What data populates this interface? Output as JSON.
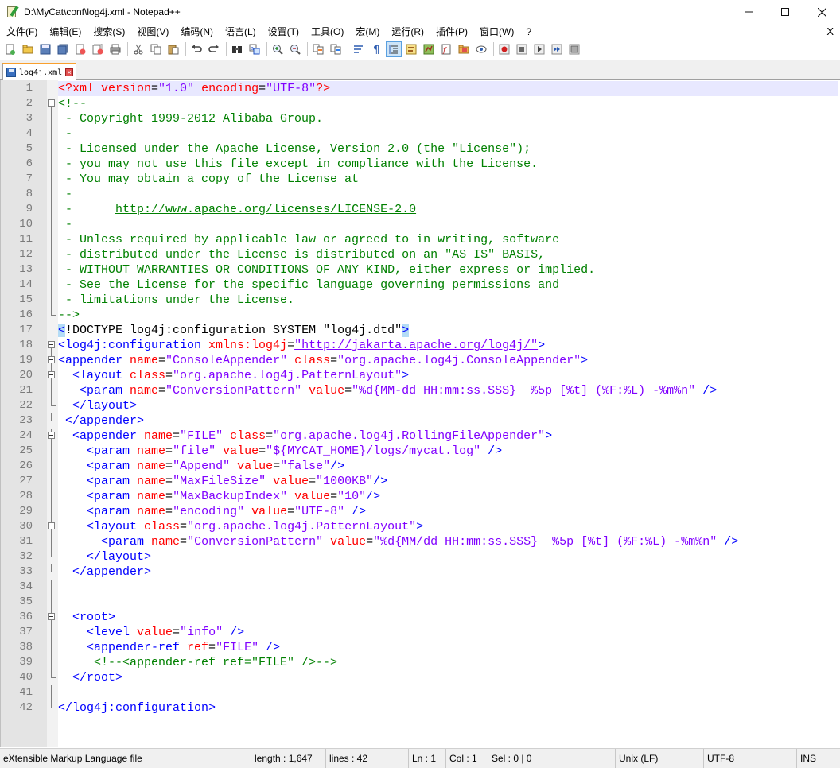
{
  "window": {
    "title": "D:\\MyCat\\conf\\log4j.xml - Notepad++",
    "minimize": "—",
    "maximize": "☐",
    "close": "✕"
  },
  "menu": {
    "items": [
      "文件(F)",
      "编辑(E)",
      "搜索(S)",
      "视图(V)",
      "编码(N)",
      "语言(L)",
      "设置(T)",
      "工具(O)",
      "宏(M)",
      "运行(R)",
      "插件(P)",
      "窗口(W)",
      "?"
    ],
    "close_doc": "X"
  },
  "tab": {
    "label": "log4j.xml",
    "close": "×"
  },
  "editor": {
    "lines": [
      "1",
      "2",
      "3",
      "4",
      "5",
      "6",
      "7",
      "8",
      "9",
      "10",
      "11",
      "12",
      "13",
      "14",
      "15",
      "16",
      "17",
      "18",
      "19",
      "20",
      "21",
      "22",
      "23",
      "24",
      "25",
      "26",
      "27",
      "28",
      "29",
      "30",
      "31",
      "32",
      "33",
      "34",
      "35",
      "36",
      "37",
      "38",
      "39",
      "40",
      "41",
      "42"
    ],
    "code": {
      "l1_a": "<?xml ",
      "l1_b": "version",
      "l1_c": "=",
      "l1_d": "\"1.0\"",
      "l1_e": " encoding",
      "l1_f": "=",
      "l1_g": "\"UTF-8\"",
      "l1_h": "?>",
      "l2": "<!--",
      "l3": " - Copyright 1999-2012 Alibaba Group.",
      "l4": " -",
      "l5": " - Licensed under the Apache License, Version 2.0 (the \"License\");",
      "l6": " - you may not use this file except in compliance with the License.",
      "l7": " - You may obtain a copy of the License at",
      "l8": " -",
      "l9_a": " -      ",
      "l9_b": "http://www.apache.org/licenses/LICENSE-2.0",
      "l10": " -",
      "l11": " - Unless required by applicable law or agreed to in writing, software",
      "l12": " - distributed under the License is distributed on an \"AS IS\" BASIS,",
      "l13": " - WITHOUT WARRANTIES OR CONDITIONS OF ANY KIND, either express or implied.",
      "l14": " - See the License for the specific language governing permissions and",
      "l15": " - limitations under the License.",
      "l16": "-->",
      "l17_a": "<",
      "l17_b": "!DOCTYPE log4j:configuration SYSTEM \"log4j.dtd\"",
      "l17_c": ">",
      "l18_a": "<log4j:configuration ",
      "l18_b": "xmlns:log4j",
      "l18_c": "=",
      "l18_d": "\"http://jakarta.apache.org/log4j/\"",
      "l18_e": ">",
      "l19_a": "<appender ",
      "l19_b": "name",
      "l19_c": "=",
      "l19_d": "\"ConsoleAppender\"",
      "l19_e": " class",
      "l19_f": "=",
      "l19_g": "\"org.apache.log4j.ConsoleAppender\"",
      "l19_h": ">",
      "l20_a": "  <layout ",
      "l20_b": "class",
      "l20_c": "=",
      "l20_d": "\"org.apache.log4j.PatternLayout\"",
      "l20_e": ">",
      "l21_a": "   <param ",
      "l21_b": "name",
      "l21_c": "=",
      "l21_d": "\"ConversionPattern\"",
      "l21_e": " value",
      "l21_f": "=",
      "l21_g": "\"%d{MM-dd HH:mm:ss.SSS}  %5p [%t] (%F:%L) -%m%n\"",
      "l21_h": " />",
      "l22": "  </layout>",
      "l23": " </appender>",
      "l24_a": "  <appender ",
      "l24_b": "name",
      "l24_c": "=",
      "l24_d": "\"FILE\"",
      "l24_e": " class",
      "l24_f": "=",
      "l24_g": "\"org.apache.log4j.RollingFileAppender\"",
      "l24_h": ">",
      "l25_a": "    <param ",
      "l25_b": "name",
      "l25_c": "=",
      "l25_d": "\"file\"",
      "l25_e": " value",
      "l25_f": "=",
      "l25_g": "\"${MYCAT_HOME}/logs/mycat.log\"",
      "l25_h": " />",
      "l26_a": "    <param ",
      "l26_b": "name",
      "l26_c": "=",
      "l26_d": "\"Append\"",
      "l26_e": " value",
      "l26_f": "=",
      "l26_g": "\"false\"",
      "l26_h": "/>",
      "l27_a": "    <param ",
      "l27_b": "name",
      "l27_c": "=",
      "l27_d": "\"MaxFileSize\"",
      "l27_e": " value",
      "l27_f": "=",
      "l27_g": "\"1000KB\"",
      "l27_h": "/>",
      "l28_a": "    <param ",
      "l28_b": "name",
      "l28_c": "=",
      "l28_d": "\"MaxBackupIndex\"",
      "l28_e": " value",
      "l28_f": "=",
      "l28_g": "\"10\"",
      "l28_h": "/>",
      "l29_a": "    <param ",
      "l29_b": "name",
      "l29_c": "=",
      "l29_d": "\"encoding\"",
      "l29_e": " value",
      "l29_f": "=",
      "l29_g": "\"UTF-8\"",
      "l29_h": " />",
      "l30_a": "    <layout ",
      "l30_b": "class",
      "l30_c": "=",
      "l30_d": "\"org.apache.log4j.PatternLayout\"",
      "l30_e": ">",
      "l31_a": "      <param ",
      "l31_b": "name",
      "l31_c": "=",
      "l31_d": "\"ConversionPattern\"",
      "l31_e": " value",
      "l31_f": "=",
      "l31_g": "\"%d{MM/dd HH:mm:ss.SSS}  %5p [%t] (%F:%L) -%m%n\"",
      "l31_h": " />",
      "l32": "    </layout>",
      "l33": "  </appender>",
      "l36": "  <root>",
      "l37_a": "    <level ",
      "l37_b": "value",
      "l37_c": "=",
      "l37_d": "\"info\"",
      "l37_e": " />",
      "l38_a": "    <appender-ref ",
      "l38_b": "ref",
      "l38_c": "=",
      "l38_d": "\"FILE\"",
      "l38_e": " />",
      "l39": "     <!--<appender-ref ref=\"FILE\" />-->",
      "l40": "  </root>",
      "l42": "</log4j:configuration>"
    }
  },
  "status": {
    "type": "eXtensible Markup Language file",
    "length": "length : 1,647",
    "lines": "lines : 42",
    "ln": "Ln : 1",
    "col": "Col : 1",
    "sel": "Sel : 0 | 0",
    "eol": "Unix (LF)",
    "encoding": "UTF-8",
    "mode": "INS"
  },
  "colors": {
    "tag": "#0000ff",
    "attr": "#ff0000",
    "value": "#8000ff",
    "comment": "#008000",
    "current_line": "#e8e8ff",
    "tab_accent": "#f9a02e"
  }
}
